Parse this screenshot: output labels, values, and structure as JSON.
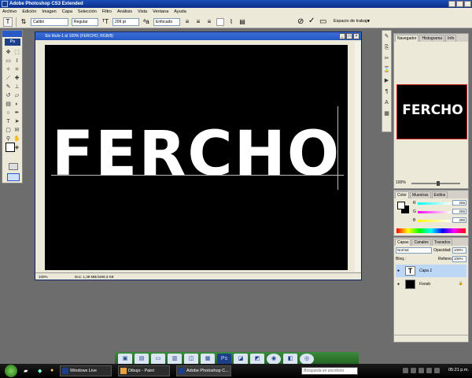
{
  "app": {
    "title": "Adobe Photoshop CS3 Extended",
    "menu": [
      "Archivo",
      "Edición",
      "Imagen",
      "Capa",
      "Selección",
      "Filtro",
      "Análisis",
      "Vista",
      "Ventana",
      "Ayuda"
    ]
  },
  "options": {
    "font_family": "Calibri",
    "font_style": "Regular",
    "font_size": "209 pt",
    "antialias": "Enfocado",
    "workspace_label": "Espacio de trabajo"
  },
  "document": {
    "title": "Sin título-1 al 100% (FERCHO, RGB/8)",
    "text": "FERCHO",
    "zoom": "100%",
    "doc_info": "Doc: 1,39 MB/4469,3 KB"
  },
  "tools": {
    "badge": "Ps",
    "items": [
      "move-tool",
      "selection-tool",
      "marquee-tool",
      "lasso-tool",
      "magic-wand-tool",
      "crop-tool",
      "slice-tool",
      "healing-tool",
      "brush-tool",
      "stamp-tool",
      "history-brush-tool",
      "eraser-tool",
      "gradient-tool",
      "blur-tool",
      "dodge-tool",
      "pen-tool",
      "type-tool",
      "path-select-tool",
      "shape-tool",
      "notes-tool",
      "eyedropper-tool",
      "hand-tool",
      "zoom-tool",
      "3d-tool"
    ]
  },
  "navigator": {
    "tabs": [
      "Navegador",
      "Histograma",
      "Info"
    ],
    "preview_text": "FERCHO",
    "zoom": "100%"
  },
  "color": {
    "tabs": [
      "Color",
      "Muestras",
      "Estilos"
    ],
    "sliders": [
      {
        "label": "R",
        "value": "255"
      },
      {
        "label": "G",
        "value": "255"
      },
      {
        "label": "B",
        "value": "255"
      }
    ]
  },
  "layers": {
    "tabs": [
      "Capas",
      "Canales",
      "Trazados"
    ],
    "blend_mode": "Normal",
    "opacity_label": "Opacidad:",
    "opacity": "100%",
    "lock_label": "Bloq.:",
    "fill_label": "Relleno:",
    "fill": "100%",
    "items": [
      {
        "name": "Capa 1",
        "thumb": "T"
      },
      {
        "name": "Fondo",
        "thumb": ""
      }
    ]
  },
  "taskbar": {
    "buttons": [
      "Windows Live Hotm...",
      "Dibujo - Paint",
      "Adobe Photoshop C..."
    ],
    "search_placeholder": "Búsqueda en escritorio",
    "clock": "05:21 p.m."
  },
  "colors": {
    "title_bar": "#0a2e8a",
    "canvas": "#000000",
    "text": "#ffffff",
    "panel": "#ece9d8",
    "navigator_border": "#cc2020"
  }
}
